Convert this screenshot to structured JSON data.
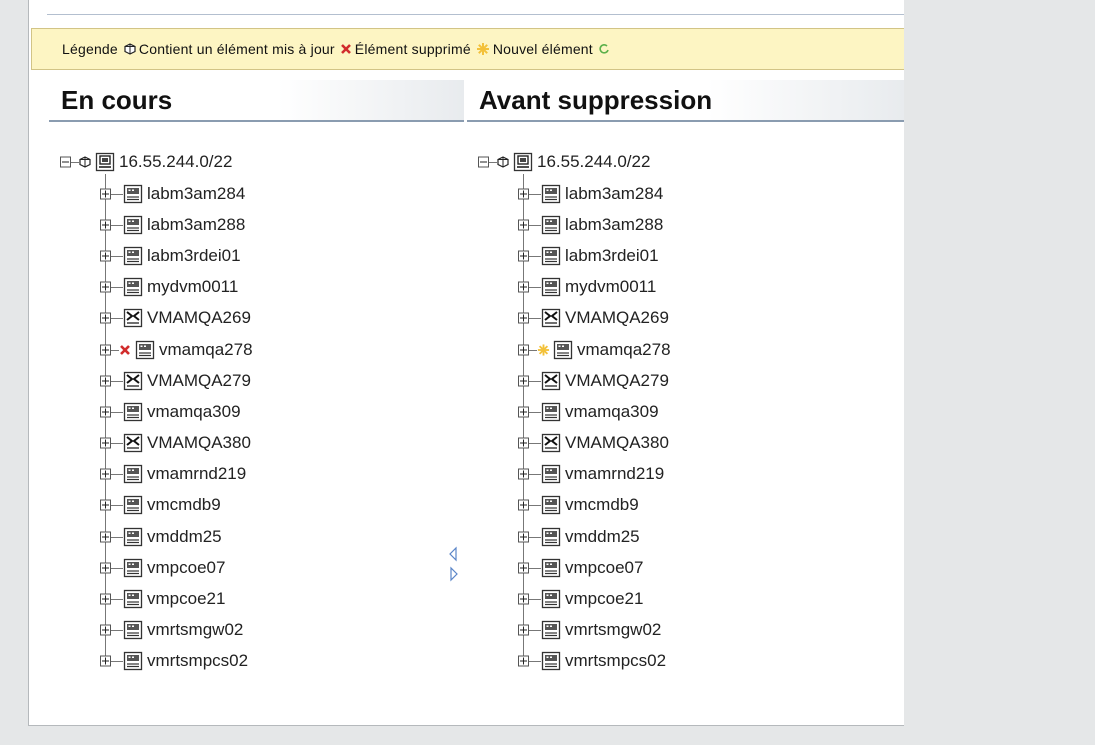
{
  "legend": {
    "title": "Légende",
    "items": [
      {
        "icon": "updated-element-icon",
        "label": "Contient un élément mis à jour"
      },
      {
        "icon": "deleted-element-icon",
        "label": "Élément supprimé"
      },
      {
        "icon": "new-element-icon",
        "label": "Nouvel élément"
      }
    ]
  },
  "left_panel": {
    "title": "En cours",
    "root": "16.55.244.0/22",
    "nodes": [
      {
        "label": "labm3am284",
        "icon": "server-icon"
      },
      {
        "label": "labm3am288",
        "icon": "server-icon"
      },
      {
        "label": "labm3rdei01",
        "icon": "server-icon"
      },
      {
        "label": "mydvm0011",
        "icon": "server-icon"
      },
      {
        "label": "VMAMQA269",
        "icon": "network-device-icon"
      },
      {
        "label": "vmamqa278",
        "icon": "server-icon",
        "status": "deleted"
      },
      {
        "label": "VMAMQA279",
        "icon": "network-device-icon"
      },
      {
        "label": "vmamqa309",
        "icon": "server-icon"
      },
      {
        "label": "VMAMQA380",
        "icon": "network-device-icon"
      },
      {
        "label": "vmamrnd219",
        "icon": "server-icon"
      },
      {
        "label": "vmcmdb9",
        "icon": "server-icon"
      },
      {
        "label": "vmddm25",
        "icon": "server-icon"
      },
      {
        "label": "vmpcoe07",
        "icon": "server-icon"
      },
      {
        "label": "vmpcoe21",
        "icon": "server-icon"
      },
      {
        "label": "vmrtsmgw02",
        "icon": "server-icon"
      },
      {
        "label": "vmrtsmpcs02",
        "icon": "server-icon"
      }
    ]
  },
  "right_panel": {
    "title": "Avant suppression",
    "root": "16.55.244.0/22",
    "nodes": [
      {
        "label": "labm3am284",
        "icon": "server-icon"
      },
      {
        "label": "labm3am288",
        "icon": "server-icon"
      },
      {
        "label": "labm3rdei01",
        "icon": "server-icon"
      },
      {
        "label": "mydvm0011",
        "icon": "server-icon"
      },
      {
        "label": "VMAMQA269",
        "icon": "network-device-icon"
      },
      {
        "label": "vmamqa278",
        "icon": "server-icon",
        "status": "new"
      },
      {
        "label": "VMAMQA279",
        "icon": "network-device-icon"
      },
      {
        "label": "vmamqa309",
        "icon": "server-icon"
      },
      {
        "label": "VMAMQA380",
        "icon": "network-device-icon"
      },
      {
        "label": "vmamrnd219",
        "icon": "server-icon"
      },
      {
        "label": "vmcmdb9",
        "icon": "server-icon"
      },
      {
        "label": "vmddm25",
        "icon": "server-icon"
      },
      {
        "label": "vmpcoe07",
        "icon": "server-icon"
      },
      {
        "label": "vmpcoe21",
        "icon": "server-icon"
      },
      {
        "label": "vmrtsmgw02",
        "icon": "server-icon"
      },
      {
        "label": "vmrtsmpcs02",
        "icon": "server-icon"
      }
    ]
  },
  "colors": {
    "deleted": "#d12c2c",
    "new": "#f3c13a",
    "legend_bg": "#fdf5c3"
  }
}
